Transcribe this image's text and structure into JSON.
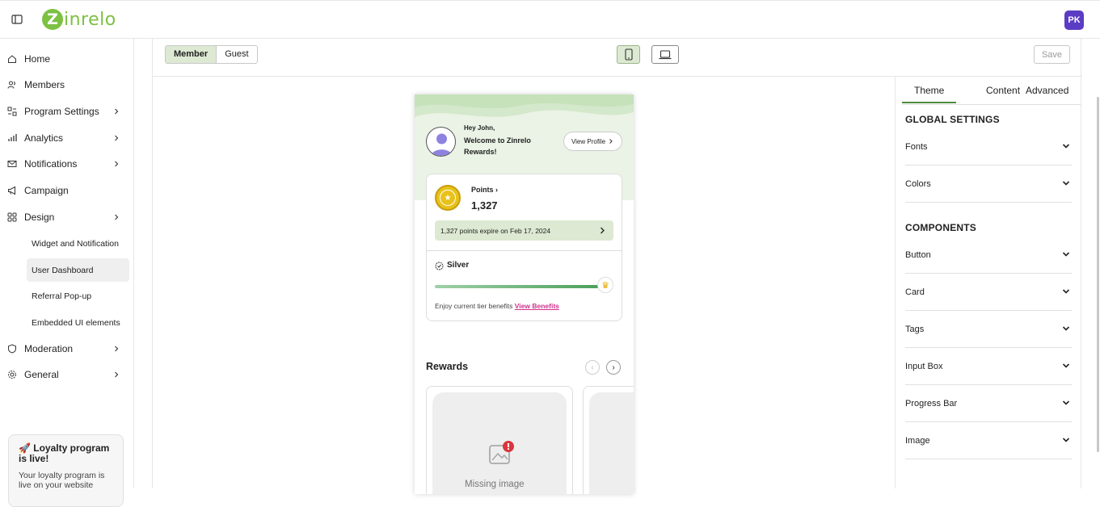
{
  "app": {
    "logo_letter": "Z",
    "logo_rest": "inrelo",
    "user_initials": "PK",
    "brand_color": "#7cc142",
    "avatar_color": "#5b3cc4"
  },
  "sidebar": {
    "items": [
      {
        "label": "Home",
        "icon": "home-icon"
      },
      {
        "label": "Members",
        "icon": "members-icon"
      },
      {
        "label": "Program Settings",
        "icon": "settings-icon"
      },
      {
        "label": "Analytics",
        "icon": "analytics-icon"
      },
      {
        "label": "Notifications",
        "icon": "mail-icon"
      },
      {
        "label": "Campaign",
        "icon": "megaphone-icon"
      },
      {
        "label": "Design",
        "icon": "design-icon"
      },
      {
        "label": "Moderation",
        "icon": "shield-icon"
      },
      {
        "label": "General",
        "icon": "gear-icon"
      }
    ],
    "design_sub": [
      {
        "label": "Widget and Notification"
      },
      {
        "label": "User Dashboard"
      },
      {
        "label": "Referral Pop-up"
      },
      {
        "label": "Embedded UI elements"
      }
    ],
    "live_card": {
      "title": "🚀 Loyalty program is live!",
      "desc": "Your loyalty program is live on your website"
    }
  },
  "toolbar": {
    "member_label": "Member",
    "guest_label": "Guest",
    "save_label": "Save"
  },
  "preview": {
    "greeting": "Hey John,",
    "welcome": "Welcome to Zinrelo Rewards!",
    "view_profile": "View Profile",
    "points_label": "Points",
    "points_value": "1,327",
    "expire_text": "1,327 points expire on Feb 17, 2024",
    "tier_name": "Silver",
    "tier_progress": 0.92,
    "enjoy_text": "Enjoy current tier benefits",
    "view_benefits": "View Benefits",
    "rewards_title": "Rewards",
    "missing_image": "Missing image"
  },
  "panel": {
    "tabs": [
      "Theme",
      "Content",
      "Advanced"
    ],
    "global_title": "GLOBAL SETTINGS",
    "global_items": [
      "Fonts",
      "Colors"
    ],
    "components_title": "COMPONENTS",
    "component_items": [
      "Button",
      "Card",
      "Tags",
      "Input Box",
      "Progress Bar",
      "Image"
    ]
  }
}
